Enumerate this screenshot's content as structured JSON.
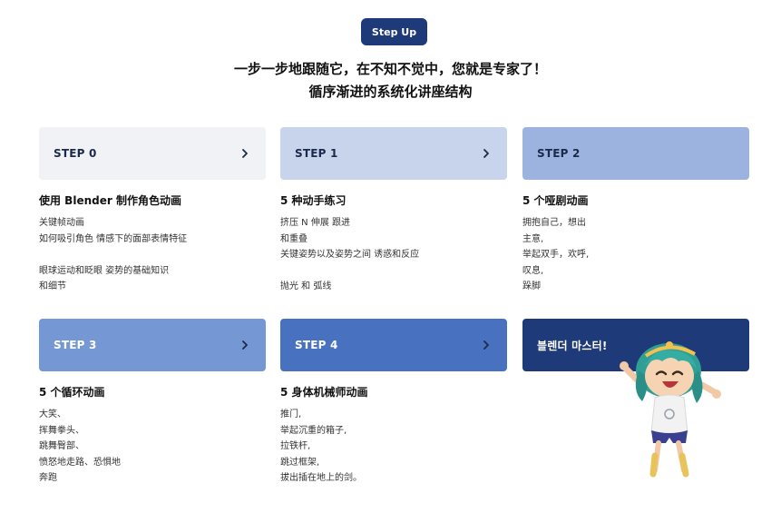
{
  "badge": "Step Up",
  "headline": {
    "line1": "一步一步地跟随它，在不知不觉中，您就是专家了！",
    "line2": "循序渐进的系统化讲座结构"
  },
  "steps": [
    {
      "label": "STEP 0",
      "title": "使用 Blender 制作角色动画",
      "lines": [
        "关键帧动画",
        "如何吸引角色 情感下的面部表情特征",
        "",
        "眼球运动和眨眼 姿势的基础知识",
        "和细节"
      ]
    },
    {
      "label": "STEP 1",
      "title": "5 种动手练习",
      "lines": [
        "挤压 N 伸展 跟进",
        "和重叠",
        "关键姿势以及姿势之间 诱惑和反应",
        "",
        "抛光 和 弧线"
      ]
    },
    {
      "label": "STEP 2",
      "title": "5 个哑剧动画",
      "lines": [
        "拥抱自己，想出",
        "主意,",
        "举起双手，欢呼,",
        "叹息,",
        "跺脚"
      ]
    },
    {
      "label": "STEP 3",
      "title": "5 个循环动画",
      "lines": [
        "大笑、",
        "挥舞拳头、",
        "跳舞臀部、",
        "愤怒地走路、恐惧地",
        "奔跑"
      ]
    },
    {
      "label": "STEP 4",
      "title": "5 身体机械师动画",
      "lines": [
        "推门,",
        "举起沉重的箱子,",
        "拉铁杆,",
        "跳过框架,",
        "拔出插在地上的剑。"
      ]
    }
  ],
  "master": {
    "label": "블렌더 마스터!"
  },
  "colors": {
    "accent": "#1f3a78",
    "step0": "#f0f2f5",
    "step1": "#c8d4ec",
    "step2": "#9db3df",
    "step3": "#7597d3",
    "step4": "#4872c0",
    "master": "#1f3a78"
  },
  "icons": {
    "card_arrow": "chevron-right-icon"
  }
}
